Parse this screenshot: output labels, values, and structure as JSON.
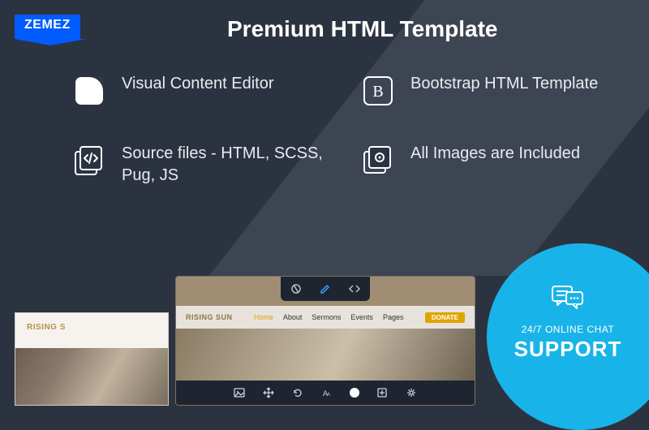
{
  "logo": "ZEMEZ",
  "title": "Premium HTML Template",
  "features": [
    {
      "icon": "content-editor-icon",
      "text": "Visual Content Editor"
    },
    {
      "icon": "bootstrap-icon",
      "text": "Bootstrap HTML Template"
    },
    {
      "icon": "source-files-icon",
      "text": "Source files - HTML, SCSS, Pug, JS"
    },
    {
      "icon": "images-icon",
      "text": "All Images are Included"
    }
  ],
  "support": {
    "line1": "24/7 ONLINE CHAT",
    "line2": "SUPPORT"
  },
  "thumbLeft": {
    "brand": "RISING S"
  },
  "editor": {
    "brand": "RISING SUN",
    "nav": [
      "Home",
      "About",
      "Sermons",
      "Events",
      "Pages"
    ],
    "donate": "DONATE"
  },
  "colors": {
    "bg": "#2c3340",
    "bgAccent": "#3d4552",
    "badge": "#005cff",
    "support": "#18b4e9"
  }
}
